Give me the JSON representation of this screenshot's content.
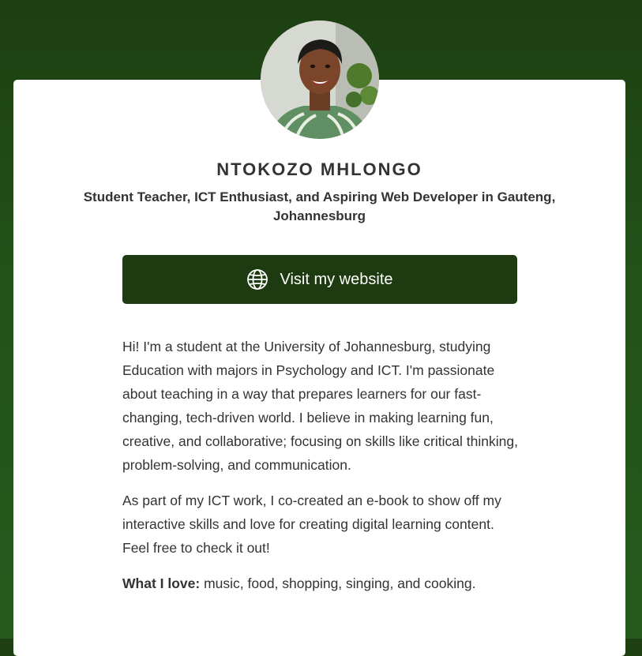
{
  "profile": {
    "name": "NTOKOZO MHLONGO",
    "headline": "Student Teacher, ICT Enthusiast, and Aspiring Web Developer in Gauteng, Johannesburg"
  },
  "website_button": {
    "label": "Visit my website",
    "icon": "globe-icon"
  },
  "bio": {
    "paragraph_1": "Hi! I'm a student at the University of Johannesburg, studying Education with majors in Psychology and ICT. I'm passionate about teaching in a way that prepares learners for our fast-changing, tech-driven world. I believe in making learning fun, creative, and collaborative; focusing on skills like critical thinking, problem-solving, and communication.",
    "paragraph_2": "As part of my ICT work, I co-created an e-book to show off my interactive skills and love for creating digital learning content. Feel free to check it out!",
    "loves_label": "What I love:",
    "loves_text": " music, food, shopping, singing, and cooking."
  },
  "colors": {
    "background": "#23521a",
    "button": "#1e3a10",
    "text": "#333333"
  }
}
